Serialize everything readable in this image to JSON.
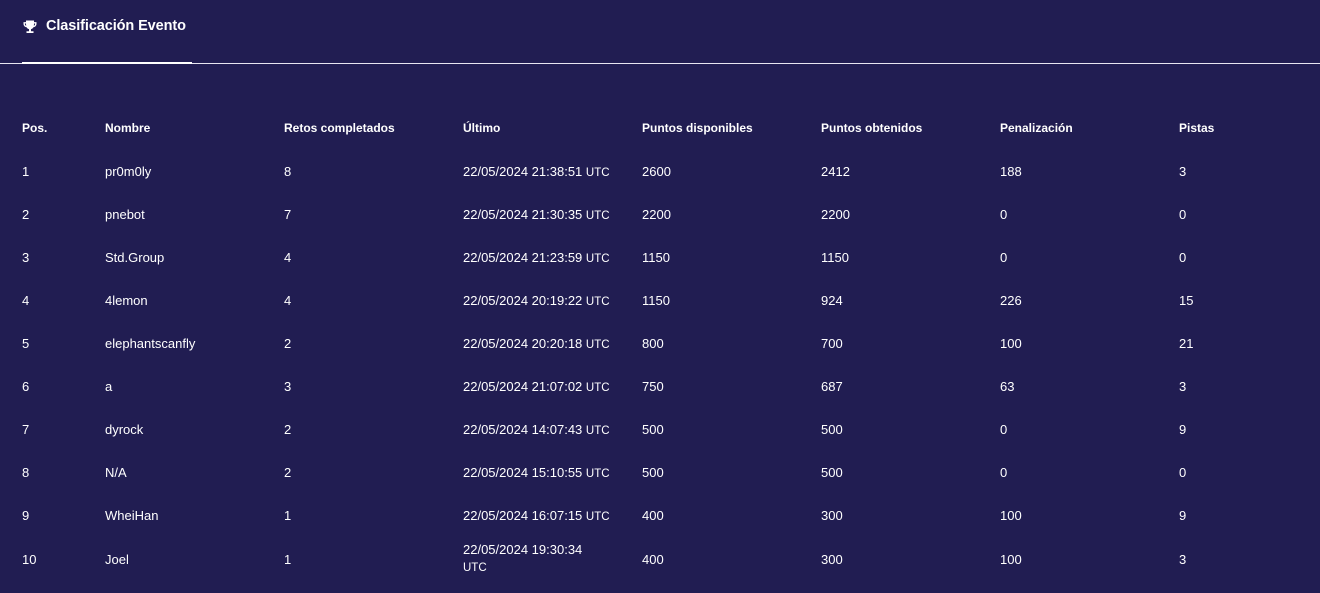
{
  "tab": {
    "icon": "trophy-icon",
    "label": "Clasificación Evento"
  },
  "columns": [
    "Pos.",
    "Nombre",
    "Retos completados",
    "Último",
    "Puntos disponibles",
    "Puntos obtenidos",
    "Penalización",
    "Pistas"
  ],
  "rows": [
    {
      "pos": "1",
      "name": "pr0m0ly",
      "retos": "8",
      "ultimo_date": "22/05/2024 21:38:51",
      "ultimo_tz": "UTC",
      "disponibles": "2600",
      "obtenidos": "2412",
      "penalizacion": "188",
      "pistas": "3"
    },
    {
      "pos": "2",
      "name": "pnebot",
      "retos": "7",
      "ultimo_date": "22/05/2024 21:30:35",
      "ultimo_tz": "UTC",
      "disponibles": "2200",
      "obtenidos": "2200",
      "penalizacion": "0",
      "pistas": "0"
    },
    {
      "pos": "3",
      "name": "Std.Group",
      "retos": "4",
      "ultimo_date": "22/05/2024 21:23:59",
      "ultimo_tz": "UTC",
      "disponibles": "1150",
      "obtenidos": "1150",
      "penalizacion": "0",
      "pistas": "0"
    },
    {
      "pos": "4",
      "name": "4lemon",
      "retos": "4",
      "ultimo_date": "22/05/2024 20:19:22",
      "ultimo_tz": "UTC",
      "disponibles": "1150",
      "obtenidos": "924",
      "penalizacion": "226",
      "pistas": "15"
    },
    {
      "pos": "5",
      "name": "elephantscanfly",
      "retos": "2",
      "ultimo_date": "22/05/2024 20:20:18",
      "ultimo_tz": "UTC",
      "disponibles": "800",
      "obtenidos": "700",
      "penalizacion": "100",
      "pistas": "21"
    },
    {
      "pos": "6",
      "name": "a",
      "retos": "3",
      "ultimo_date": "22/05/2024 21:07:02",
      "ultimo_tz": "UTC",
      "disponibles": "750",
      "obtenidos": "687",
      "penalizacion": "63",
      "pistas": "3"
    },
    {
      "pos": "7",
      "name": "dyrock",
      "retos": "2",
      "ultimo_date": "22/05/2024 14:07:43",
      "ultimo_tz": "UTC",
      "disponibles": "500",
      "obtenidos": "500",
      "penalizacion": "0",
      "pistas": "9"
    },
    {
      "pos": "8",
      "name": "N/A",
      "retos": "2",
      "ultimo_date": "22/05/2024 15:10:55",
      "ultimo_tz": "UTC",
      "disponibles": "500",
      "obtenidos": "500",
      "penalizacion": "0",
      "pistas": "0"
    },
    {
      "pos": "9",
      "name": "WheiHan",
      "retos": "1",
      "ultimo_date": "22/05/2024 16:07:15",
      "ultimo_tz": "UTC",
      "disponibles": "400",
      "obtenidos": "300",
      "penalizacion": "100",
      "pistas": "9"
    },
    {
      "pos": "10",
      "name": "Joel",
      "retos": "1",
      "ultimo_date": "22/05/2024 19:30:34",
      "ultimo_tz": "UTC",
      "disponibles": "400",
      "obtenidos": "300",
      "penalizacion": "100",
      "pistas": "3"
    }
  ]
}
